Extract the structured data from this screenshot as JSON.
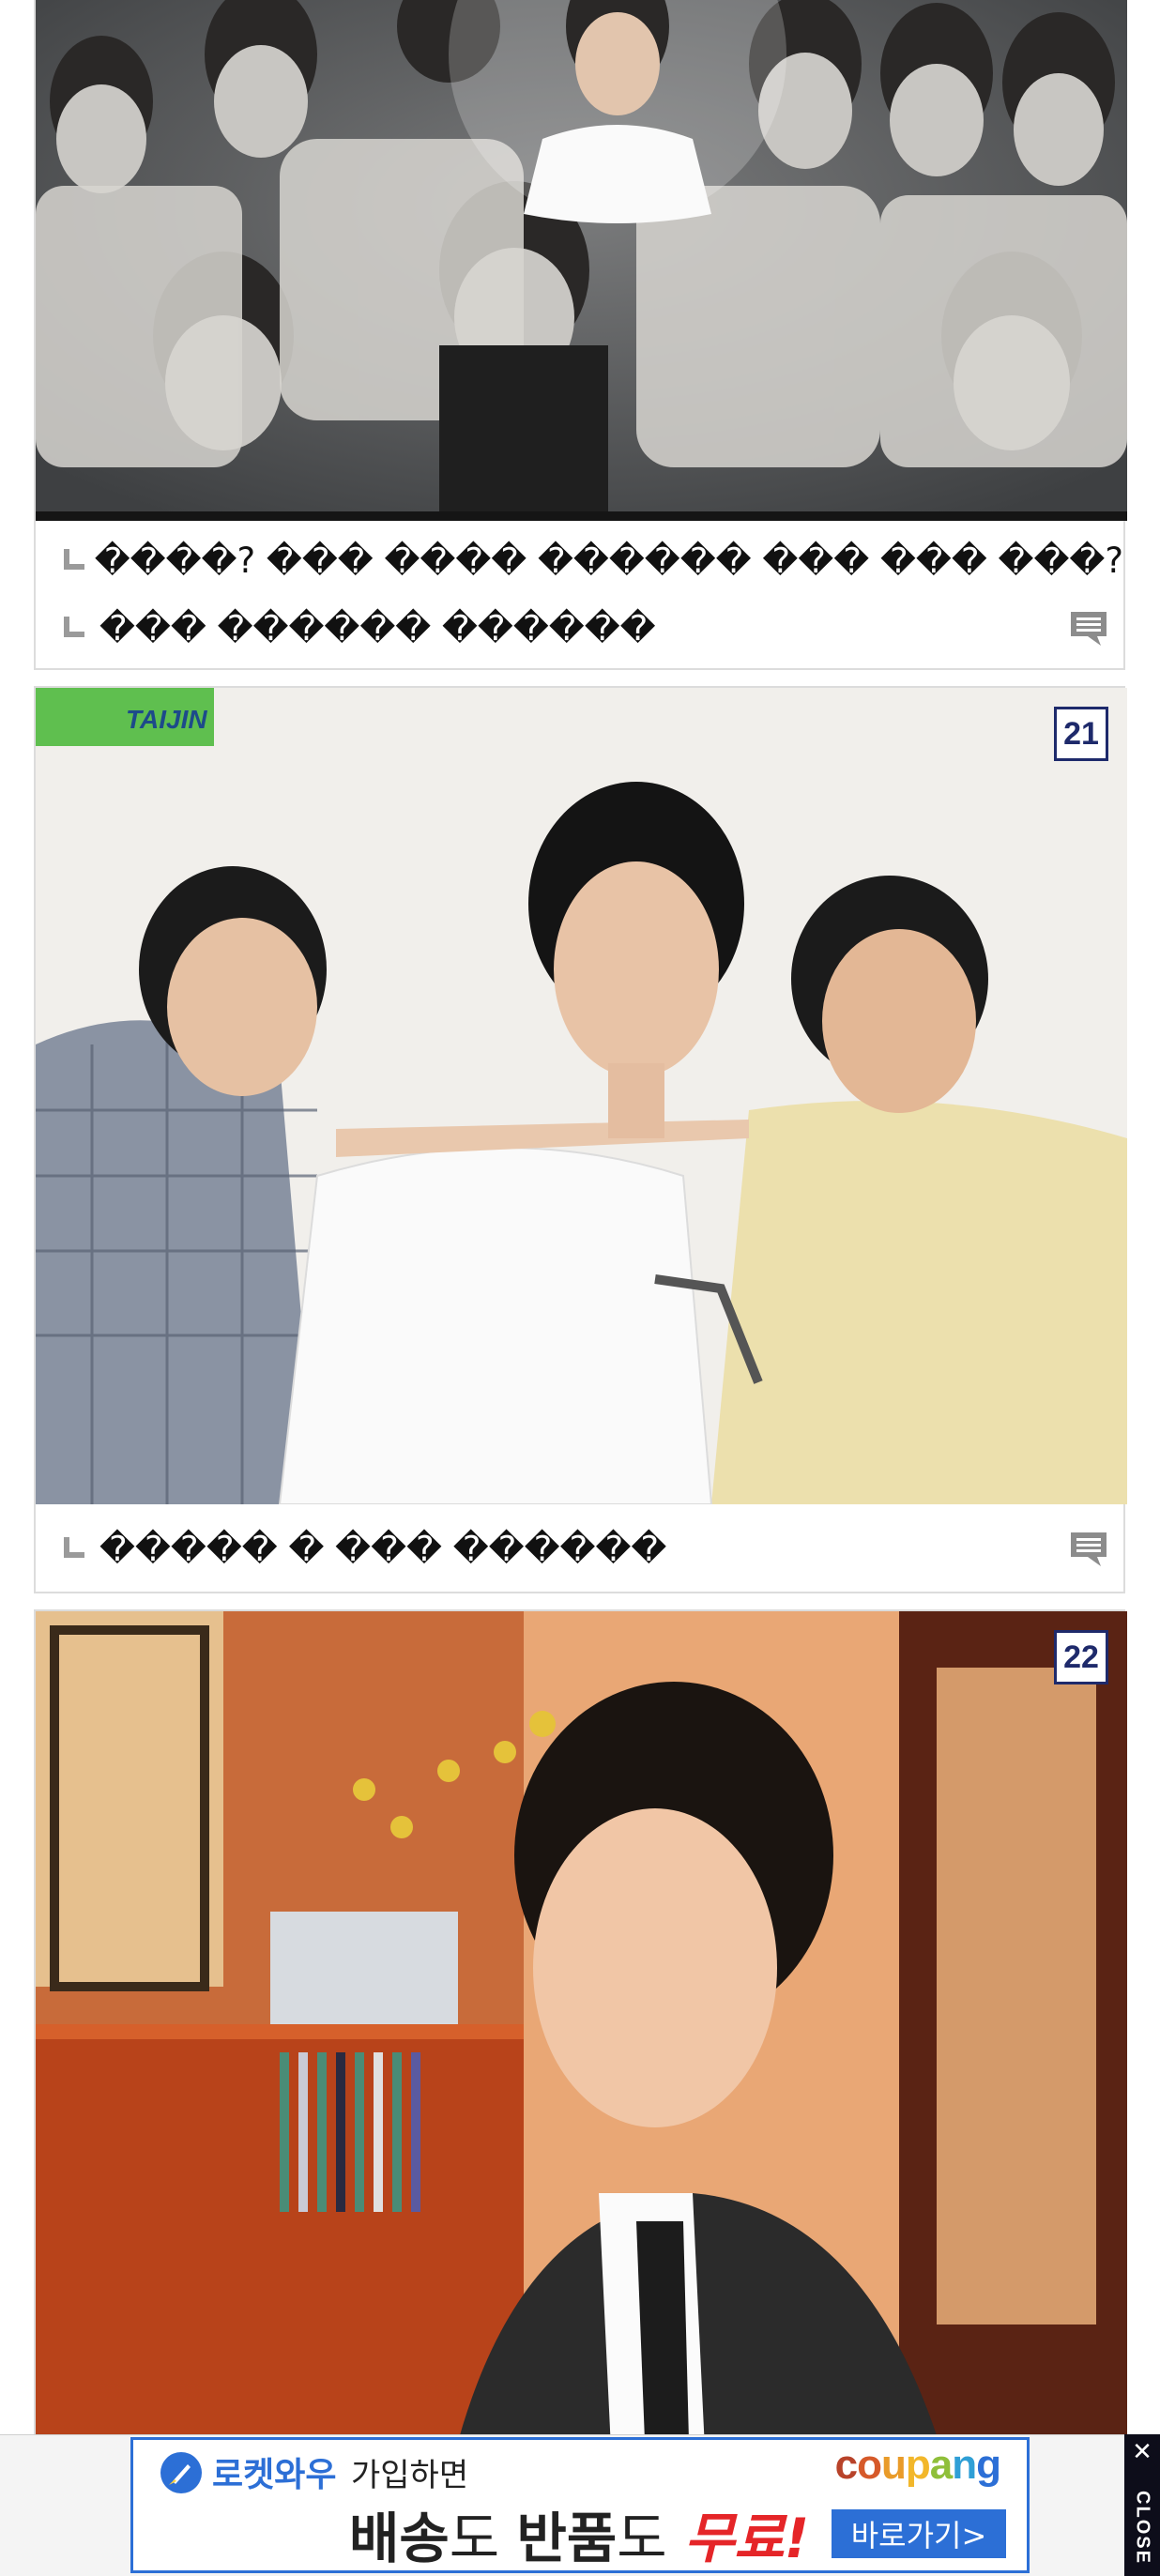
{
  "cards": [
    {
      "comments": [
        {
          "text": "�� ��? �� �� �� �� �� �� �� �� ��?",
          "display": "����? ��� ���� ������ ��� ��� ���?"
        },
        {
          "text": "��� ������ ������",
          "display": "��� ������ ������"
        }
      ]
    },
    {
      "badge": "21",
      "photo_watermark": "TAIJIN",
      "comments": [
        {
          "display": "����� � ��� ������"
        }
      ]
    },
    {
      "badge": "22"
    }
  ],
  "ad": {
    "rocket_label": "로켓와우",
    "join_label": "가입하면",
    "brand": "coupang",
    "headline_part1": "배송",
    "headline_part2": "도 ",
    "headline_part3": "반품",
    "headline_part4": "도 ",
    "headline_part5": "무료!",
    "cta": "바로가기>"
  },
  "close": {
    "label": "CLOSE",
    "icon": "close-icon"
  },
  "colors": {
    "badge_border": "#1e2a6b",
    "coupang_accent": "#2c6fd6",
    "free_red": "#e52528"
  }
}
